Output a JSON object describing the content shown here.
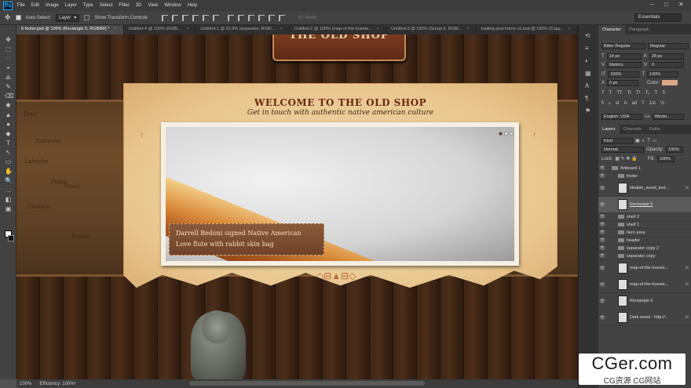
{
  "app": {
    "logo": "Ps"
  },
  "menu": [
    "File",
    "Edit",
    "Image",
    "Layer",
    "Type",
    "Select",
    "Filter",
    "3D",
    "View",
    "Window",
    "Help"
  ],
  "window_controls": {
    "minimize": "–",
    "maximize": "□",
    "close": "✕"
  },
  "options_bar": {
    "auto_select_label": "Auto-Select:",
    "auto_select_value": "Layer",
    "transform_label": "Show Transform Controls",
    "mode_3d": "3D Mode:",
    "workspace": "Essentials"
  },
  "doc_tabs": [
    {
      "label": "6 footer.psd @ 100% (Rectangle 5, RGB/8#) *",
      "active": true
    },
    {
      "label": "Untitled-4 @ 100% (RGB/...",
      "active": false
    },
    {
      "label": "Untitled-1 @ 63.9% (separator, RGB/...",
      "active": false
    },
    {
      "label": "Untitled-2 @ 100% (map-of-the-hueste...",
      "active": false
    },
    {
      "label": "Untitled-3 @ 100% (Group 6, RGB/...",
      "active": false
    },
    {
      "label": "trading post home v2.psd @ 100% (Copy...",
      "active": false
    }
  ],
  "tools": [
    "✥",
    "⬚",
    "◌",
    "⌖",
    "⟁",
    "✎",
    "⌫",
    "✱",
    "▲",
    "●",
    "◆",
    "T",
    "↖",
    "▭",
    "✋",
    "🔍",
    "…",
    "◧",
    "▣"
  ],
  "canvas": {
    "sign_text": "THE OLD SHOP",
    "hero_title": "WELCOME TO THE OLD SHOP",
    "hero_subtitle": "Get in touch with authentic native american culture",
    "caption_line1": "Darrell Bedoni signed Native American",
    "caption_line2": "Love flute with rabbit skin bag",
    "map_labels": [
      "Tanu",
      "Tanteohe",
      "Lahuche",
      "Pupia",
      "Tewal",
      "Cumaca",
      "Pumel"
    ]
  },
  "status": {
    "zoom": "100%",
    "info": "Efficiency: 100%*"
  },
  "character_panel": {
    "tabs": [
      "Character",
      "Paragraph"
    ],
    "font_family": "Bitter Regular",
    "font_style": "Regular",
    "font_size": "14 px",
    "leading": "28 px",
    "kerning": "Metrics",
    "tracking": "0",
    "vscale": "100%",
    "hscale": "100%",
    "baseline": "0 px",
    "color_label": "Color:",
    "color_hex": "#d9a787",
    "styles": [
      "T",
      "T",
      "TT",
      "Tr",
      "T¹",
      "T₁",
      "T",
      "T̶"
    ],
    "opentype": [
      "fi",
      "ℴ",
      "st",
      "A",
      "ad",
      "T",
      "1st",
      "½"
    ],
    "language": "English: USA",
    "aa_prefix": "aa",
    "antialias": "Windo..."
  },
  "layers_panel": {
    "tabs": [
      "Layers",
      "Channels",
      "Paths"
    ],
    "filter": "Kind",
    "blend": "Normal",
    "opacity_label": "Opacity:",
    "opacity": "100%",
    "lock_label": "Lock:",
    "fill_label": "Fill:",
    "fill": "100%",
    "layers": [
      {
        "name": "Artboard 1",
        "kind": "artboard",
        "tall": false,
        "fx": false,
        "sel": false
      },
      {
        "name": "footer",
        "kind": "folder",
        "tall": false,
        "fx": false,
        "sel": false
      },
      {
        "name": "tileable_wood_text...",
        "kind": "image",
        "tall": true,
        "fx": true,
        "sel": false
      },
      {
        "name": "Rectangle 5",
        "kind": "image",
        "tall": true,
        "fx": false,
        "sel": true
      },
      {
        "name": "shelf 2",
        "kind": "folder",
        "tall": false,
        "fx": false,
        "sel": false
      },
      {
        "name": "shelf 1",
        "kind": "folder",
        "tall": false,
        "fx": false,
        "sel": false
      },
      {
        "name": "hero area",
        "kind": "folder",
        "tall": false,
        "fx": false,
        "sel": false
      },
      {
        "name": "header",
        "kind": "folder",
        "tall": false,
        "fx": false,
        "sel": false
      },
      {
        "name": "separator copy 2",
        "kind": "folder",
        "tall": false,
        "fx": false,
        "sel": false
      },
      {
        "name": "separator copy",
        "kind": "folder",
        "tall": false,
        "fx": false,
        "sel": false
      },
      {
        "name": "map-of-the-hueste...",
        "kind": "image",
        "tall": true,
        "fx": true,
        "sel": false
      },
      {
        "name": "map-of-the-hueste...",
        "kind": "image",
        "tall": true,
        "fx": true,
        "sel": false
      },
      {
        "name": "Rectangle 6",
        "kind": "image",
        "tall": true,
        "fx": false,
        "sel": false
      },
      {
        "name": "Dark wood - http://...",
        "kind": "image",
        "tall": true,
        "fx": true,
        "sel": false
      }
    ]
  },
  "watermark": {
    "main": "CGer.com",
    "sub": "CG资源 CG网站"
  }
}
